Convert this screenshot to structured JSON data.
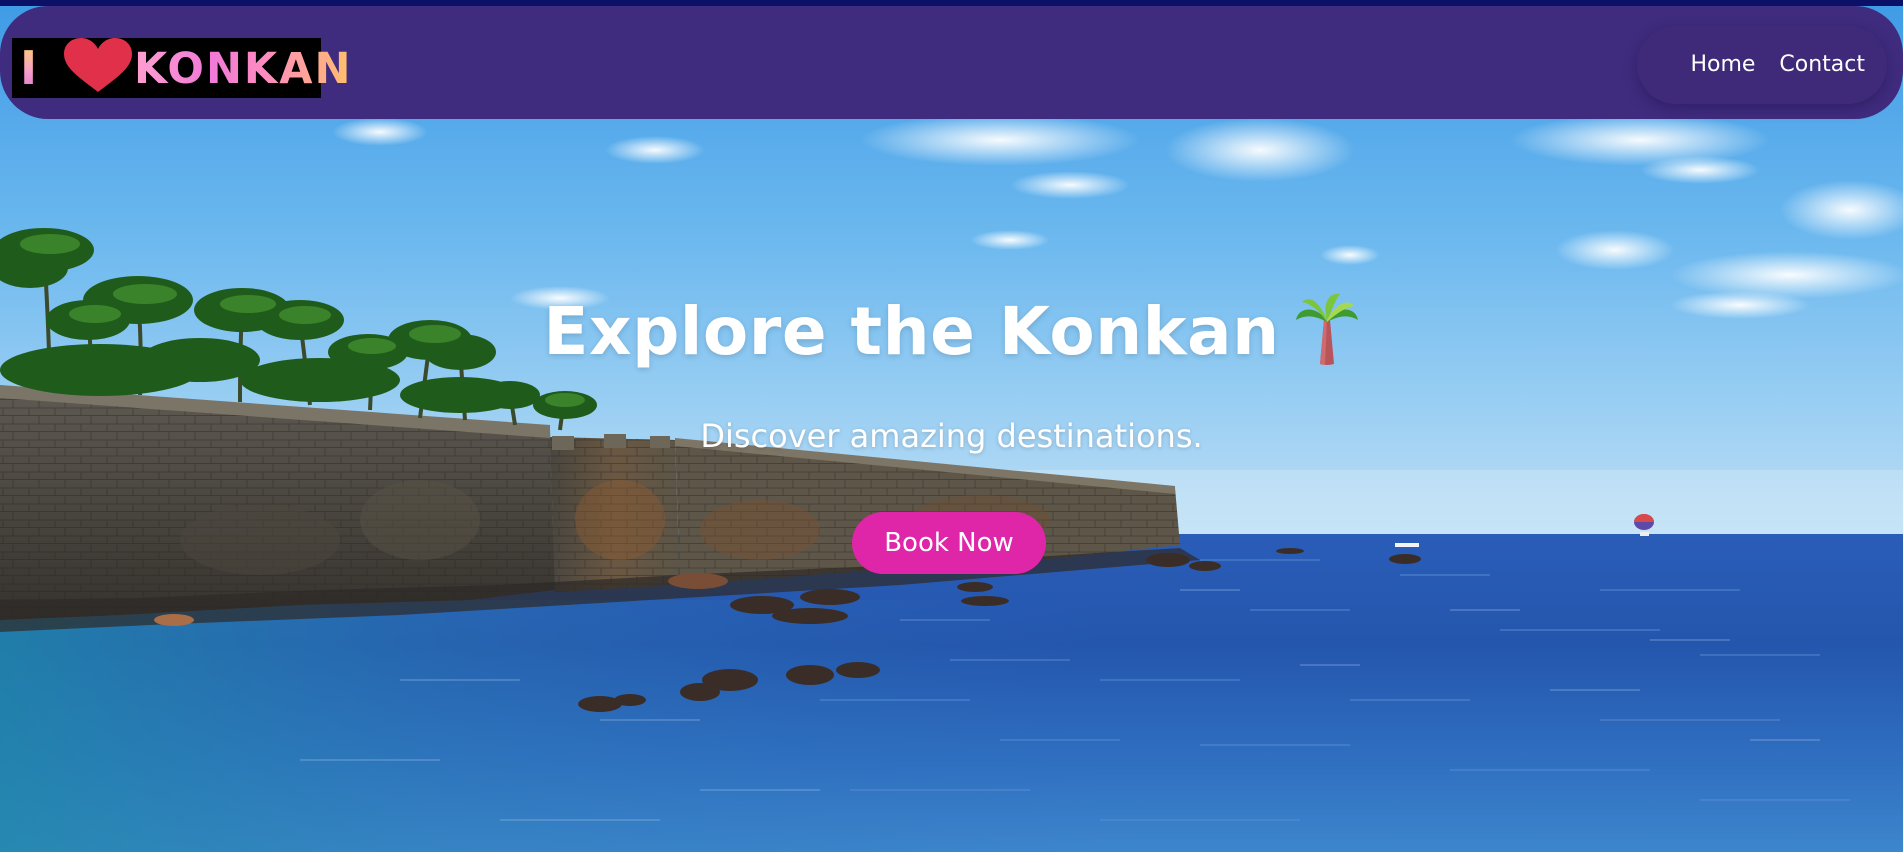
{
  "navbar": {
    "logo": {
      "prefix": "I",
      "word": "KONKAN",
      "heart_icon": "heart-icon"
    },
    "links": [
      {
        "label": "Home"
      },
      {
        "label": "Contact"
      }
    ]
  },
  "hero": {
    "title": "Explore the Konkan",
    "title_icon": "palm-tree-icon",
    "subtitle": "Discover amazing destinations.",
    "cta_label": "Book Now",
    "background_image": "sea fort wall with palm trees beside the ocean"
  },
  "colors": {
    "navbar_bg": "#402c7e",
    "top_strip": "#0b1166",
    "cta_bg": "#e026a8",
    "text": "#ffffff"
  }
}
